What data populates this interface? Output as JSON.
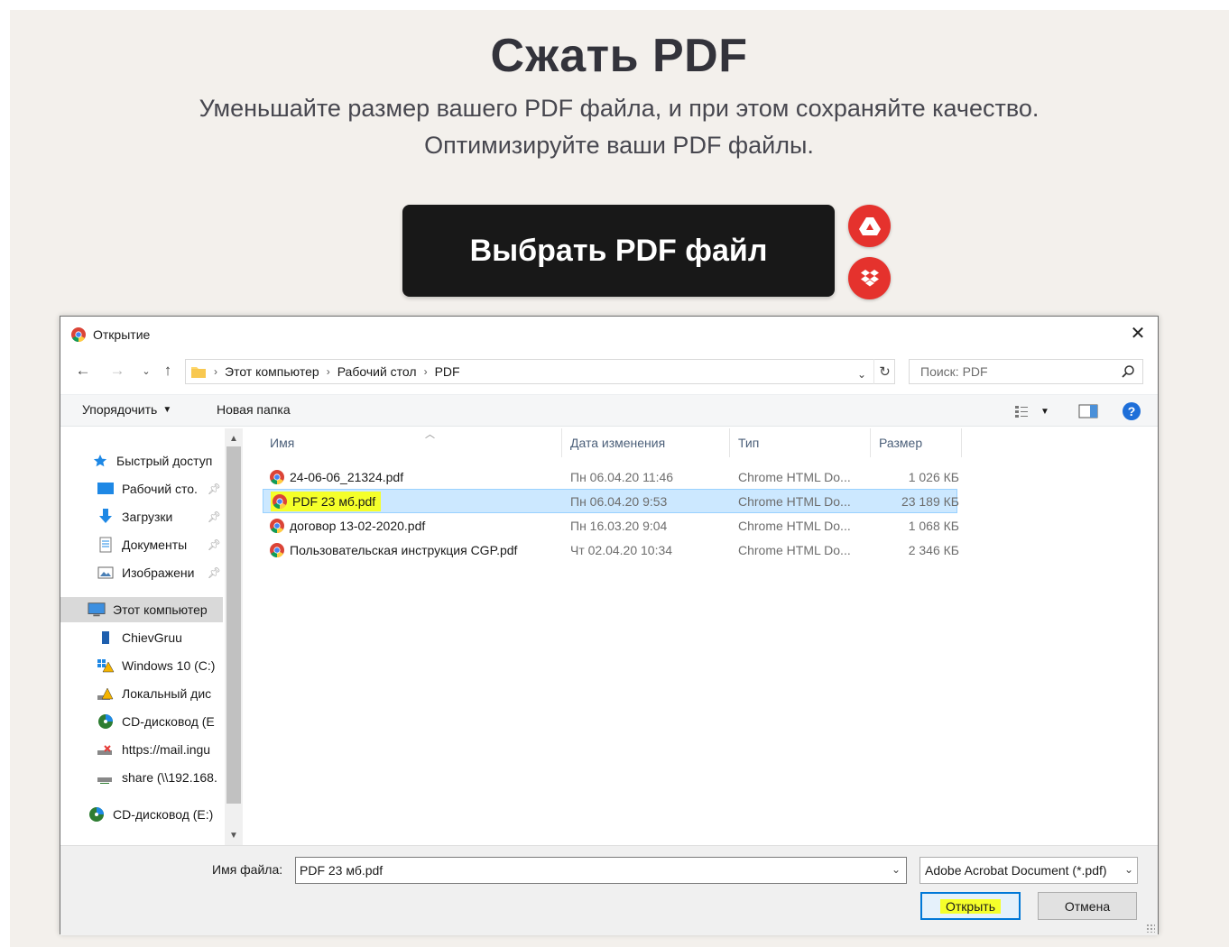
{
  "hero": {
    "title": "Сжать PDF",
    "subtitle_line1": "Уменьшайте размер вашего PDF файла, и при этом сохраняйте качество.",
    "subtitle_line2": "Оптимизируйте ваши PDF файлы.",
    "select_button": "Выбрать PDF файл",
    "accent_color": "#e5322d"
  },
  "dialog": {
    "title": "Открытие",
    "breadcrumb": [
      "Этот компьютер",
      "Рабочий стол",
      "PDF"
    ],
    "search_placeholder": "Поиск: PDF",
    "toolbar": {
      "organize": "Упорядочить",
      "new_folder": "Новая папка"
    },
    "nav": {
      "quick_access": "Быстрый доступ",
      "desktop": "Рабочий сто.",
      "downloads": "Загрузки",
      "documents": "Документы",
      "images": "Изображени",
      "this_pc": "Этот компьютер",
      "chievgruu": "ChievGruu",
      "windows": "Windows 10 (C:)",
      "local_disk": "Локальный дис",
      "cd_drive_sub": "CD-дисковод (E",
      "mail": "https://mail.ingu",
      "share": "share (\\\\192.168.",
      "cd_drive": "CD-дисковод (E:)"
    },
    "columns": {
      "name": "Имя",
      "date": "Дата изменения",
      "type": "Тип",
      "size": "Размер"
    },
    "files": [
      {
        "name": "24-06-06_21324.pdf",
        "date": "Пн 06.04.20 11:46",
        "type": "Chrome HTML Do...",
        "size": "1 026 КБ"
      },
      {
        "name": "PDF 23 мб.pdf",
        "date": "Пн 06.04.20 9:53",
        "type": "Chrome HTML Do...",
        "size": "23 189 КБ"
      },
      {
        "name": "договор 13-02-2020.pdf",
        "date": "Пн 16.03.20 9:04",
        "type": "Chrome HTML Do...",
        "size": "1 068 КБ"
      },
      {
        "name": "Пользовательская инструкция CGP.pdf",
        "date": "Чт 02.04.20 10:34",
        "type": "Chrome HTML Do...",
        "size": "2 346 КБ"
      }
    ],
    "filename_label": "Имя файла:",
    "filename_value": "PDF 23 мб.pdf",
    "filetype_value": "Adobe Acrobat Document (*.pdf)",
    "open_button": "Открыть",
    "cancel_button": "Отмена"
  }
}
